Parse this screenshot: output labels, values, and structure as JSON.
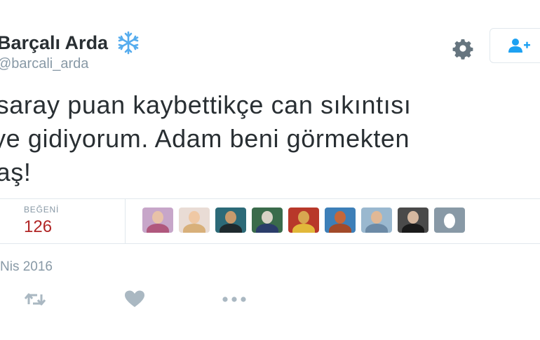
{
  "user": {
    "display_name": "Barçalı Arda",
    "screen_name": "@barcali_arda",
    "badge_icon": "snowflake-icon"
  },
  "header": {
    "settings_icon": "gear-icon",
    "follow_icon": "add-user-icon"
  },
  "tweet": {
    "text": "asaray puan kaybettikçe can sıkıntısı\ni'ye gidiyorum. Adam beni görmekten\ndaş!"
  },
  "stats": {
    "likes_label": "BEĞENİ",
    "likes_count": "126",
    "likes_color": "#b12626",
    "liker_avatars_count": 9
  },
  "meta": {
    "date": "Nis 2016"
  },
  "actions": {
    "retweet_icon": "retweet-icon",
    "like_icon": "heart-icon",
    "more_icon": "more-dots-icon"
  },
  "colors": {
    "text": "#292f33",
    "muted": "#8899a6",
    "border": "#e1e8ed",
    "accent": "#1da1f2"
  }
}
